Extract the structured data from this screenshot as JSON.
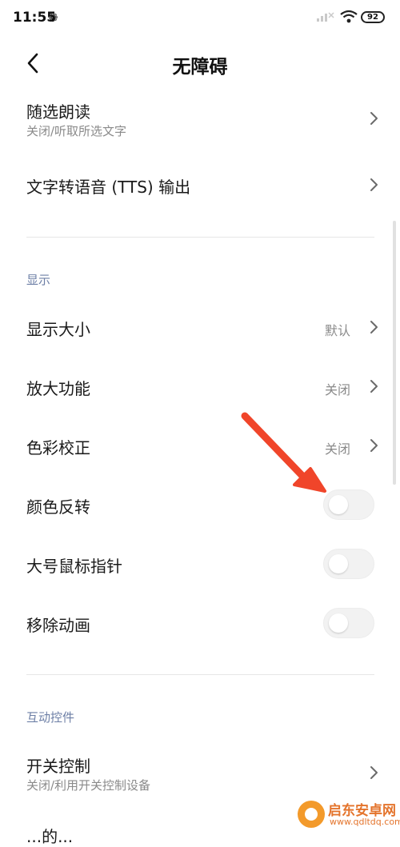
{
  "status_bar": {
    "time": "11:55",
    "battery": "92"
  },
  "header": {
    "title": "无障碍"
  },
  "items": {
    "select_to_speak": {
      "title": "随选朗读",
      "subtitle": "关闭/听取所选文字"
    },
    "tts_output": {
      "title": "文字转语音 (TTS) 输出"
    },
    "display_size": {
      "title": "显示大小",
      "value": "默认"
    },
    "magnification": {
      "title": "放大功能",
      "value": "关闭"
    },
    "color_correction": {
      "title": "色彩校正",
      "value": "关闭"
    },
    "color_inversion": {
      "title": "颜色反转",
      "enabled": false
    },
    "large_pointer": {
      "title": "大号鼠标指针",
      "enabled": false
    },
    "remove_animations": {
      "title": "移除动画",
      "enabled": false
    },
    "switch_access": {
      "title": "开关控制",
      "subtitle": "关闭/利用开关控制设备"
    },
    "cut_off_item": {
      "title": "...的..."
    }
  },
  "sections": {
    "display": "显示",
    "interaction_controls": "互动控件"
  },
  "watermark": {
    "name": "启东安卓网",
    "url": "www.qdltdq.com"
  },
  "colors": {
    "section_header": "#6d7fa6",
    "annotation_arrow": "#f0452a",
    "toggle_off": "#f2f2f2"
  }
}
